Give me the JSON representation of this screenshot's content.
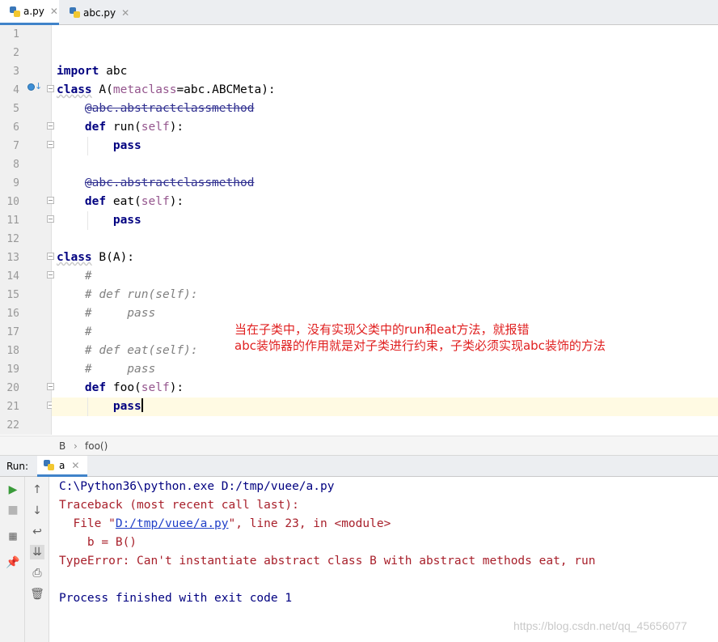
{
  "tabs": [
    {
      "label": "a.py",
      "active": true
    },
    {
      "label": "abc.py",
      "active": false
    }
  ],
  "editor": {
    "line_numbers": [
      "1",
      "2",
      "3",
      "4",
      "5",
      "6",
      "7",
      "8",
      "9",
      "10",
      "11",
      "12",
      "13",
      "14",
      "15",
      "16",
      "17",
      "18",
      "19",
      "20",
      "21",
      "22"
    ],
    "lines": {
      "l3_kw": "import",
      "l3_rest": " abc",
      "l4_kw": "class",
      "l4_a": " A(",
      "l4_param": "metaclass",
      "l4_b": "=abc.ABCMeta):",
      "l5_deco": "@abc.abstractclassmethod",
      "l6_kw": "def",
      "l6_a": " run(",
      "l6_param": "self",
      "l6_b": "):",
      "l7_kw": "pass",
      "l9_deco": "@abc.abstractclassmethod",
      "l10_kw": "def",
      "l10_a": " eat(",
      "l10_param": "self",
      "l10_b": "):",
      "l11_kw": "pass",
      "l13_kw": "class",
      "l13_a": " B(A):",
      "l14_cmt": "#",
      "l15_cmt": "# def run(self):",
      "l16_cmt": "#     pass",
      "l17_cmt": "#",
      "l18_cmt": "# def eat(self):",
      "l19_cmt": "#     pass",
      "l20_kw": "def",
      "l20_a": " foo(",
      "l20_param": "self",
      "l20_b": "):",
      "l21_kw": "pass"
    },
    "annotation": {
      "line1": "当在子类中，没有实现父类中的run和eat方法，就报错",
      "line2": "abc装饰器的作用就是对子类进行约束，子类必须实现abc装饰的方法"
    }
  },
  "breadcrumb": {
    "items": [
      "B",
      "foo()"
    ],
    "separator": "›"
  },
  "run": {
    "label": "Run:",
    "tab_label": "a",
    "output": {
      "cmd": "C:\\Python36\\python.exe D:/tmp/vuee/a.py",
      "traceback": "Traceback (most recent call last):",
      "file_prefix": "  File \"",
      "file_link": "D:/tmp/vuee/a.py",
      "file_suffix": "\", line 23, in <module>",
      "code": "    b = B()",
      "error": "TypeError: Can't instantiate abstract class B with abstract methods eat, run",
      "finished": "Process finished with exit code 1"
    }
  },
  "watermark": "https://blog.csdn.net/qq_45656077"
}
